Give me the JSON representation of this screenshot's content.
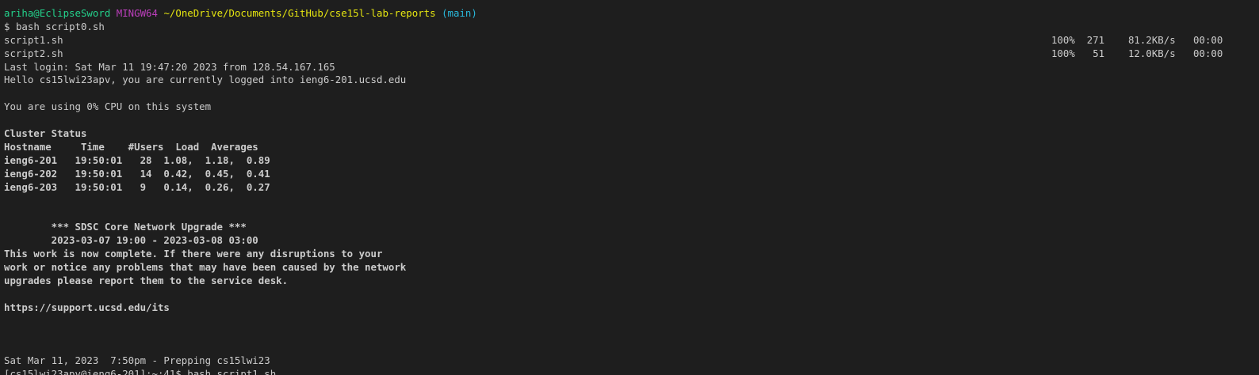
{
  "prompt": {
    "user_host": "ariha@EclipseSword",
    "shell": "MINGW64",
    "path": "~/OneDrive/Documents/GitHub/cse15l-lab-reports",
    "branch": "(main)",
    "symbol": "$",
    "command": "bash script0.sh"
  },
  "transfers": [
    {
      "file": "script1.sh",
      "stats": "100%  271    81.2KB/s   00:00"
    },
    {
      "file": "script2.sh",
      "stats": "100%   51    12.0KB/s   00:00"
    }
  ],
  "login": {
    "last_login": "Last login: Sat Mar 11 19:47:20 2023 from 128.54.167.165",
    "hello": "Hello cs15lwi23apv, you are currently logged into ieng6-201.ucsd.edu",
    "cpu": "You are using 0% CPU on this system"
  },
  "cluster": {
    "title": "Cluster Status",
    "header": "Hostname     Time    #Users  Load  Averages",
    "rows": [
      "ieng6-201   19:50:01   28  1.08,  1.18,  0.89",
      "ieng6-202   19:50:01   14  0.42,  0.45,  0.41",
      "ieng6-203   19:50:01   9   0.14,  0.26,  0.27"
    ]
  },
  "notice": {
    "title": "        *** SDSC Core Network Upgrade ***",
    "dates": "        2023-03-07 19:00 - 2023-03-08 03:00",
    "body": [
      "This work is now complete. If there were any disruptions to your",
      "work or notice any problems that may have been caused by the network",
      "upgrades please report them to the service desk."
    ],
    "url": "https://support.ucsd.edu/its"
  },
  "footer": {
    "prepping": "Sat Mar 11, 2023  7:50pm - Prepping cs15lwi23",
    "next_prompt": "[cs15lwi23apv@ieng6-201]:~:41$ bash script1.sh"
  }
}
